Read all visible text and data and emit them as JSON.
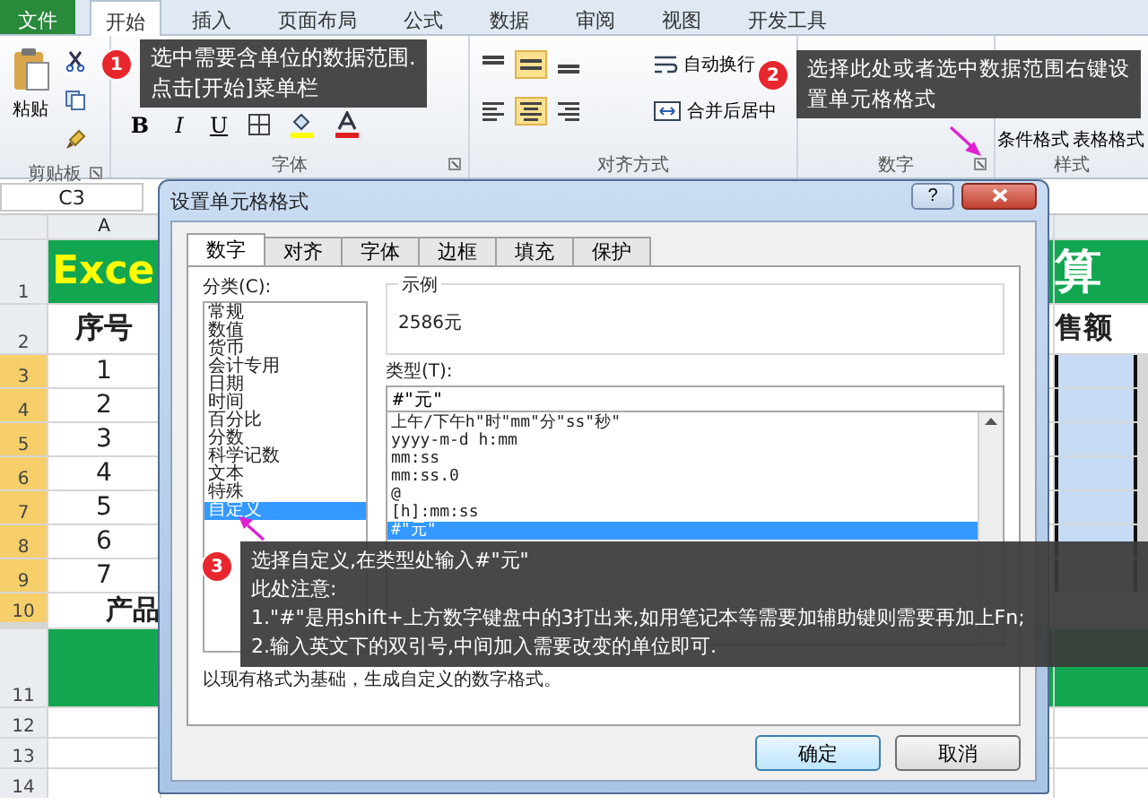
{
  "ribbon": {
    "tabs": [
      {
        "label": "文件",
        "kind": "file",
        "selected": false
      },
      {
        "label": "开始",
        "kind": "tab",
        "selected": true
      },
      {
        "label": "插入",
        "kind": "tab",
        "selected": false
      },
      {
        "label": "页面布局",
        "kind": "tab",
        "selected": false
      },
      {
        "label": "公式",
        "kind": "tab",
        "selected": false
      },
      {
        "label": "数据",
        "kind": "tab",
        "selected": false
      },
      {
        "label": "审阅",
        "kind": "tab",
        "selected": false
      },
      {
        "label": "视图",
        "kind": "tab",
        "selected": false
      },
      {
        "label": "开发工具",
        "kind": "tab",
        "selected": false
      }
    ],
    "clipboard": {
      "paste": "粘贴",
      "label": "剪贴板"
    },
    "font": {
      "format_buttons": [
        "B",
        "I",
        "U"
      ],
      "label": "字体"
    },
    "alignment": {
      "vertical": [
        {
          "selected": false
        },
        {
          "selected": true
        },
        {
          "selected": false
        }
      ],
      "horizontal": [
        {
          "selected": false
        },
        {
          "selected": true
        },
        {
          "selected": false
        }
      ],
      "wrap": "自动换行",
      "merge": "合并后居中",
      "label": "对齐方式"
    },
    "number": {
      "label": "数字"
    },
    "styles": {
      "buttons": [
        "条件格式",
        "表格格式"
      ],
      "label": "样式"
    }
  },
  "name_box": "C3",
  "sheet": {
    "column_header": "A",
    "rows": [
      {
        "number": "1",
        "kind": "title",
        "selected": false,
        "a": "Exce",
        "right": "算"
      },
      {
        "number": "2",
        "kind": "header",
        "selected": false,
        "a": "序号",
        "right": "售额"
      },
      {
        "number": "3",
        "kind": "data",
        "selected": true,
        "a": "1"
      },
      {
        "number": "4",
        "kind": "data",
        "selected": true,
        "a": "2"
      },
      {
        "number": "5",
        "kind": "data",
        "selected": true,
        "a": "3"
      },
      {
        "number": "6",
        "kind": "data",
        "selected": true,
        "a": "4"
      },
      {
        "number": "7",
        "kind": "data",
        "selected": true,
        "a": "5"
      },
      {
        "number": "8",
        "kind": "data",
        "selected": true,
        "a": "6"
      },
      {
        "number": "9",
        "kind": "data",
        "selected": true,
        "a": "7"
      },
      {
        "number": "10",
        "kind": "footer",
        "selected": true,
        "a": "产品"
      },
      {
        "number": "11",
        "kind": "band",
        "selected": false
      },
      {
        "number": "12",
        "kind": "empty",
        "selected": false
      },
      {
        "number": "13",
        "kind": "empty",
        "selected": false
      },
      {
        "number": "14",
        "kind": "empty",
        "selected": false
      }
    ]
  },
  "dialog": {
    "title": "设置单元格格式",
    "help": "?",
    "tabs": [
      {
        "label": "数字",
        "selected": true
      },
      {
        "label": "对齐",
        "selected": false
      },
      {
        "label": "字体",
        "selected": false
      },
      {
        "label": "边框",
        "selected": false
      },
      {
        "label": "填充",
        "selected": false
      },
      {
        "label": "保护",
        "selected": false
      }
    ],
    "category_label": "分类(C):",
    "categories": [
      {
        "label": "常规",
        "selected": false
      },
      {
        "label": "数值",
        "selected": false
      },
      {
        "label": "货币",
        "selected": false
      },
      {
        "label": "会计专用",
        "selected": false
      },
      {
        "label": "日期",
        "selected": false
      },
      {
        "label": "时间",
        "selected": false
      },
      {
        "label": "百分比",
        "selected": false
      },
      {
        "label": "分数",
        "selected": false
      },
      {
        "label": "科学记数",
        "selected": false
      },
      {
        "label": "文本",
        "selected": false
      },
      {
        "label": "特殊",
        "selected": false
      },
      {
        "label": "自定义",
        "selected": true
      }
    ],
    "sample_label": "示例",
    "sample": "2586元",
    "type_label": "类型(T):",
    "type_value": "#\"元\"",
    "types": [
      {
        "label": "上午/下午h\"时\"mm\"分\"ss\"秒\"",
        "selected": false
      },
      {
        "label": "yyyy-m-d h:mm",
        "selected": false
      },
      {
        "label": "mm:ss",
        "selected": false
      },
      {
        "label": "mm:ss.0",
        "selected": false
      },
      {
        "label": "@",
        "selected": false
      },
      {
        "label": "[h]:mm:ss",
        "selected": false
      },
      {
        "label": "#\"元\"",
        "selected": true
      }
    ],
    "description": "以现有格式为基础，生成自定义的数字格式。",
    "buttons": [
      "确定",
      "取消"
    ]
  },
  "callouts": [
    {
      "number": "1",
      "lines": [
        "选中需要含单位的数据范围.",
        "点击[开始]菜单栏"
      ]
    },
    {
      "number": "2",
      "lines": [
        "选择此处或者选中数据范围右键设",
        "置单元格格式"
      ]
    },
    {
      "number": "3",
      "lines": [
        "选择自定义,在类型处输入#\"元\"",
        "此处注意:",
        "1.\"#\"是用shift+上方数字键盘中的3打出来,如用笔记本等需要加辅助键则需要再加上Fn;",
        "2.输入英文下的双引号,中间加入需要改变的单位即可."
      ]
    }
  ]
}
